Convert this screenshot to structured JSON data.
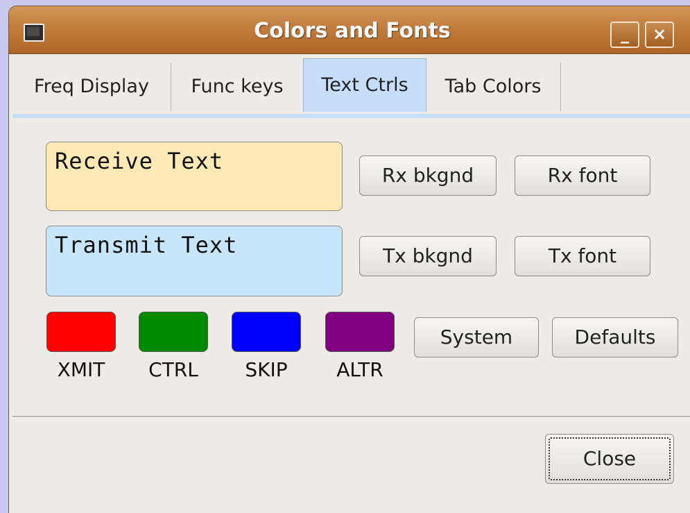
{
  "window": {
    "title": "Colors and Fonts"
  },
  "tabs": [
    {
      "label": "Freq Display"
    },
    {
      "label": "Func keys"
    },
    {
      "label": "Text Ctrls"
    },
    {
      "label": "Tab Colors"
    }
  ],
  "rx": {
    "sample": "Receive Text",
    "bkgnd_label": "Rx bkgnd",
    "font_label": "Rx font",
    "bg_color": "#ffeab5"
  },
  "tx": {
    "sample": "Transmit Text",
    "bkgnd_label": "Tx bkgnd",
    "font_label": "Tx font",
    "bg_color": "#c8e6fb"
  },
  "swatches": [
    {
      "label": "XMIT",
      "color": "#ff0000"
    },
    {
      "label": "CTRL",
      "color": "#008a00"
    },
    {
      "label": "SKIP",
      "color": "#0000ff"
    },
    {
      "label": "ALTR",
      "color": "#800080"
    }
  ],
  "buttons": {
    "system": "System",
    "defaults": "Defaults",
    "close": "Close"
  },
  "icons": {
    "window": "window-icon",
    "minimize": "minimize-icon",
    "close": "close-icon"
  }
}
